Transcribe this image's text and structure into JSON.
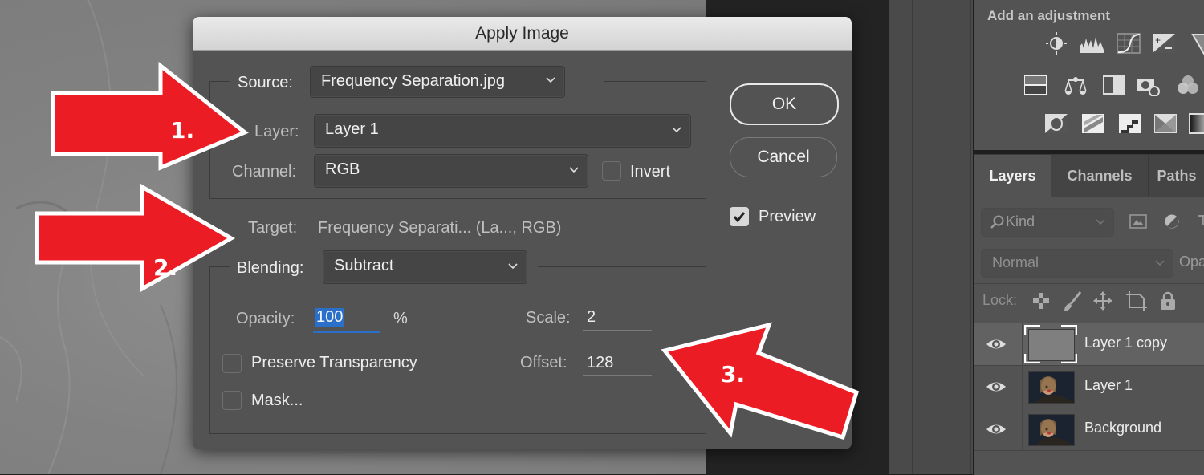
{
  "dialog": {
    "title": "Apply Image",
    "source": {
      "label": "Source:",
      "value": "Frequency Separation.jpg"
    },
    "layer": {
      "label": "Layer:",
      "value": "Layer 1"
    },
    "channel": {
      "label": "Channel:",
      "value": "RGB"
    },
    "invert": {
      "label": "Invert",
      "checked": false
    },
    "target": {
      "label": "Target:",
      "value": "Frequency Separati... (La..., RGB)"
    },
    "blending": {
      "label": "Blending:",
      "value": "Subtract"
    },
    "opacity": {
      "label": "Opacity:",
      "value": "100",
      "unit": "%"
    },
    "scale": {
      "label": "Scale:",
      "value": "2"
    },
    "offset": {
      "label": "Offset:",
      "value": "128"
    },
    "preserve_transparency": {
      "label": "Preserve Transparency",
      "checked": false
    },
    "mask": {
      "label": "Mask...",
      "checked": false
    },
    "ok_label": "OK",
    "cancel_label": "Cancel",
    "preview": {
      "label": "Preview",
      "checked": true
    }
  },
  "annotations": [
    {
      "number": "1.",
      "points_to": "Layer"
    },
    {
      "number": "2.",
      "points_to": "Blending"
    },
    {
      "number": "3.",
      "points_to": "Scale / Offset"
    }
  ],
  "adjustments_panel": {
    "title": "Add an adjustment",
    "icons": [
      [
        "brightness-contrast-icon",
        "levels-icon",
        "curves-icon",
        "exposure-icon",
        "vibrance-icon"
      ],
      [
        "hue-saturation-icon",
        "color-balance-icon",
        "black-white-icon",
        "photo-filter-icon",
        "channel-mixer-icon"
      ],
      [
        "invert-icon",
        "posterize-icon",
        "threshold-icon",
        "selective-color-icon",
        "gradient-map-icon"
      ]
    ]
  },
  "layers_panel": {
    "tabs": [
      "Layers",
      "Channels",
      "Paths"
    ],
    "active_tab": "Layers",
    "filter": {
      "value": "Kind"
    },
    "blend_mode": "Normal",
    "opacity_label": "Opa",
    "lock_label": "Lock:",
    "layers": [
      {
        "name": "Layer 1 copy",
        "visible": true,
        "selected": true,
        "thumb": "gray"
      },
      {
        "name": "Layer 1",
        "visible": true,
        "selected": false,
        "thumb": "photo"
      },
      {
        "name": "Background",
        "visible": true,
        "selected": false,
        "thumb": "photo"
      }
    ]
  },
  "colors": {
    "arrow_red": "#ec1c24",
    "selection_blue": "#2a6fc9",
    "panel_bg": "#535353"
  }
}
